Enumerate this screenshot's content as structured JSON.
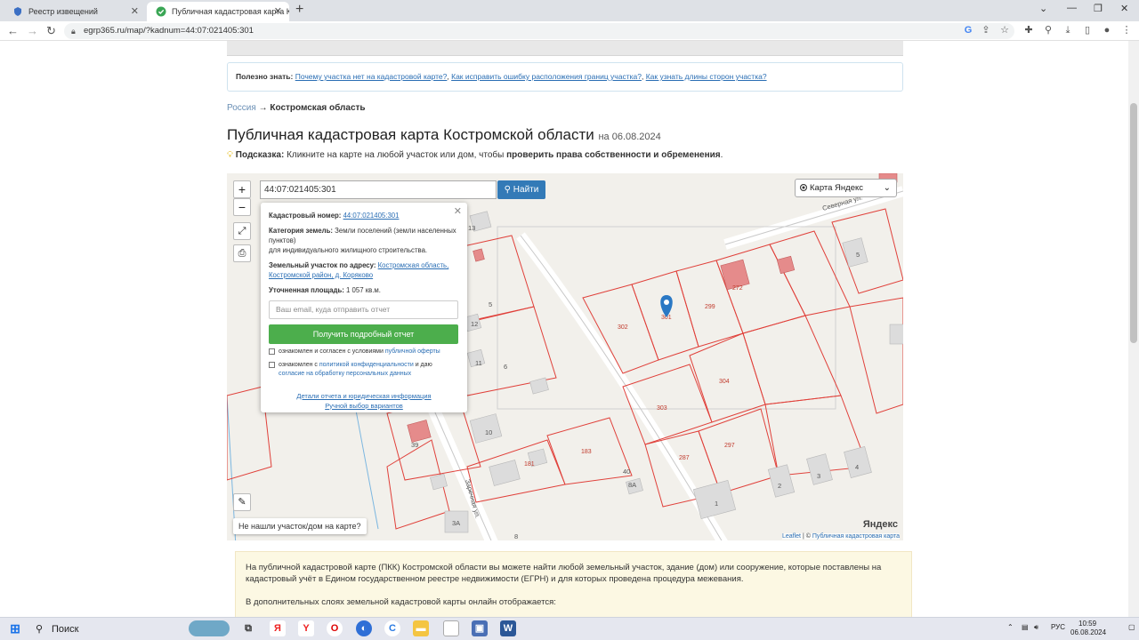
{
  "browser": {
    "tabs": [
      {
        "label": "Реестр извещений",
        "active": false
      },
      {
        "label": "Публичная кадастровая карта К",
        "active": true
      }
    ],
    "url": "egrp365.ru/map/?kadnum=44:07:021405:301"
  },
  "page": {
    "tip": {
      "prefix": "Полезно знать:",
      "links": [
        "Почему участка нет на кадастровой карте?",
        "Как исправить ошибку расположения границ участка?",
        "Как узнать длины сторон участка?"
      ]
    },
    "breadcrumb": {
      "root": "Россия",
      "arrow": "→",
      "current": "Костромская область"
    },
    "title": "Публичная кадастровая карта Костромской области",
    "title_date": "на 06.08.2024",
    "hint": {
      "label": "Подсказка:",
      "text": "Кликните на карте на любой участок или дом, чтобы",
      "bold": "проверить права собственности и обременения",
      "end": "."
    }
  },
  "map": {
    "zoom_in": "+",
    "zoom_out": "−",
    "search_value": "44:07:021405:301",
    "search_button": "Найти",
    "layer": "Карта Яндекс",
    "not_found": "Не нашли участок/дом на карте?",
    "attribution_leaflet": "Leaflet",
    "attribution_sep": "| ©",
    "attribution_link": "Публичная кадастровая карта",
    "yandex": "Яндекс",
    "street_severnaya": "Северная ул.",
    "street_zarechnaya": "Заречная ул.",
    "popup": {
      "kadnum_label": "Кадастровый номер:",
      "kadnum": "44:07:021405:301",
      "category_label": "Категория земель:",
      "category": "Земли поселений (земли населенных пунктов)",
      "use": "для индивидуального жилищного строительства.",
      "address_label": "Земельный участок по адресу:",
      "address": "Костромская область, Костромской район, д. Коряково",
      "area_label": "Уточненная площадь:",
      "area": "1 057 кв.м.",
      "email_placeholder": "Ваш email, куда отправить отчет",
      "get_report": "Получить подробный отчет",
      "agree1_text": "ознакомлен и согласен с условиями",
      "agree1_link": "публичной оферты",
      "agree2_text": "ознакомлен с",
      "agree2_link": "политикой конфиденциальности",
      "agree2_text2": "и даю",
      "agree2_link2": "согласие на обработку персональных данных",
      "details_link": "Детали отчета и юридическая информация",
      "manual_link": "Ручной выбор вариантов"
    },
    "parcel_labels": [
      "302",
      "301",
      "299",
      "304",
      "303",
      "297",
      "287",
      "183",
      "181",
      "272",
      "13",
      "12",
      "11",
      "10",
      "39",
      "40",
      "5",
      "6",
      "8",
      "8А",
      "3А",
      "1",
      "2",
      "3",
      "4",
      "5"
    ]
  },
  "info": {
    "p1": "На публичной кадастровой карте (ПКК) Костромской области вы можете найти любой земельный участок, здание (дом) или сооружение, которые поставлены на кадастровый учёт в Едином государственном реестре недвижимости (ЕГРН) и для которых проведена процедура межевания.",
    "p2": "В дополнительных слоях земельной кадастровой карты онлайн отображается:"
  },
  "taskbar": {
    "search": "Поиск",
    "lang": "РУС",
    "time": "10:59",
    "date": "06.08.2024"
  },
  "colors": {
    "accent": "#337ab7",
    "green": "#4cae4c",
    "parcel": "#e0403a",
    "link": "#2a6eb4"
  }
}
